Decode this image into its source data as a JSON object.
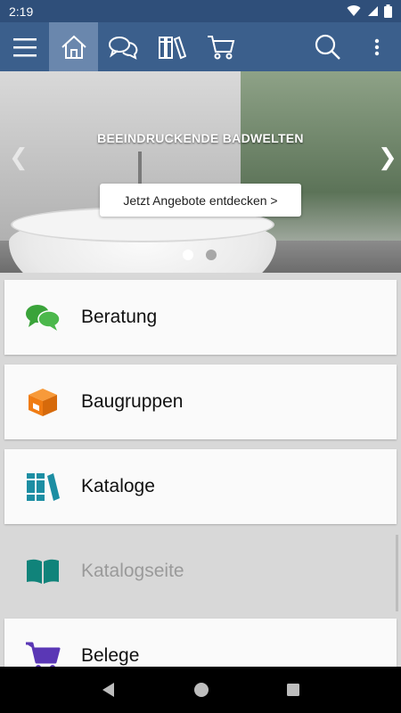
{
  "status_bar": {
    "time": "2:19"
  },
  "banner": {
    "title": "BEEINDRUCKENDE BADWELTEN",
    "cta_label": "Jetzt Angebote entdecken >",
    "prev_glyph": "❮",
    "next_glyph": "❯",
    "slide_count": 2,
    "active_slide": 1
  },
  "toolbar": {
    "icons": [
      "menu-icon",
      "home-icon",
      "chat-icon",
      "books-icon",
      "cart-icon",
      "search-icon",
      "more-vert-icon"
    ]
  },
  "menu": {
    "items": [
      {
        "label": "Beratung",
        "icon": "chat-bubbles-icon",
        "color": "#3aa33a"
      },
      {
        "label": "Baugruppen",
        "icon": "box-icon",
        "color": "#f07c13"
      },
      {
        "label": "Kataloge",
        "icon": "books-icon",
        "color": "#1c8ea3"
      },
      {
        "label": "Katalogseite",
        "icon": "open-book-icon",
        "color": "#10837a"
      },
      {
        "label": "Belege",
        "icon": "cart-icon",
        "color": "#5a37b5"
      }
    ]
  },
  "colors": {
    "toolbar": "#3b5f8c",
    "status_bar": "#2f4f7a",
    "toolbar_active": "#6a87ad"
  }
}
